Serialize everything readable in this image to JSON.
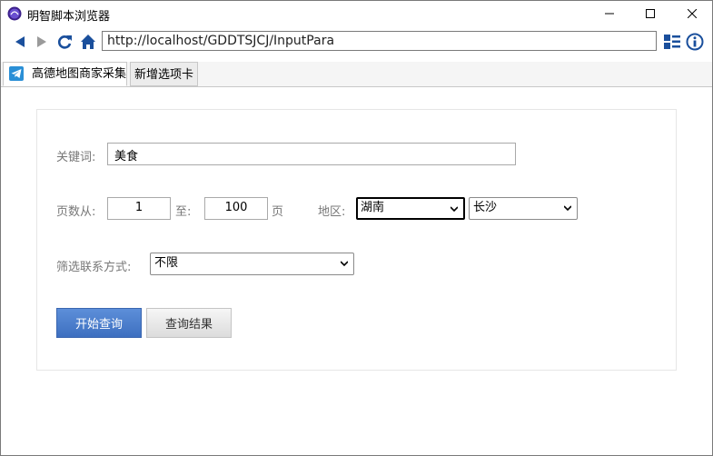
{
  "window": {
    "title": "明智脚本浏览器",
    "icon": "app-logo-icon"
  },
  "nav": {
    "url": "http://localhost/GDDTSJCJ/InputPara"
  },
  "tabs": [
    {
      "label": "高德地图商家采集",
      "icon": "telegram-plane-icon",
      "active": true
    },
    {
      "label": "新增选项卡",
      "active": false
    }
  ],
  "form": {
    "keyword_label": "关键词:",
    "keyword_value": "美食",
    "pages_label": "页数从:",
    "page_from": "1",
    "to_label": "至:",
    "page_to": "100",
    "page_unit": "页",
    "region_label": "地区:",
    "province": "湖南",
    "city": "长沙",
    "filter_label": "筛选联系方式:",
    "filter_value": "不限",
    "start_button": "开始查询",
    "results_button": "查询结果"
  },
  "colors": {
    "primary_button": "#4a7ccc",
    "accent": "#1a5fb4"
  }
}
